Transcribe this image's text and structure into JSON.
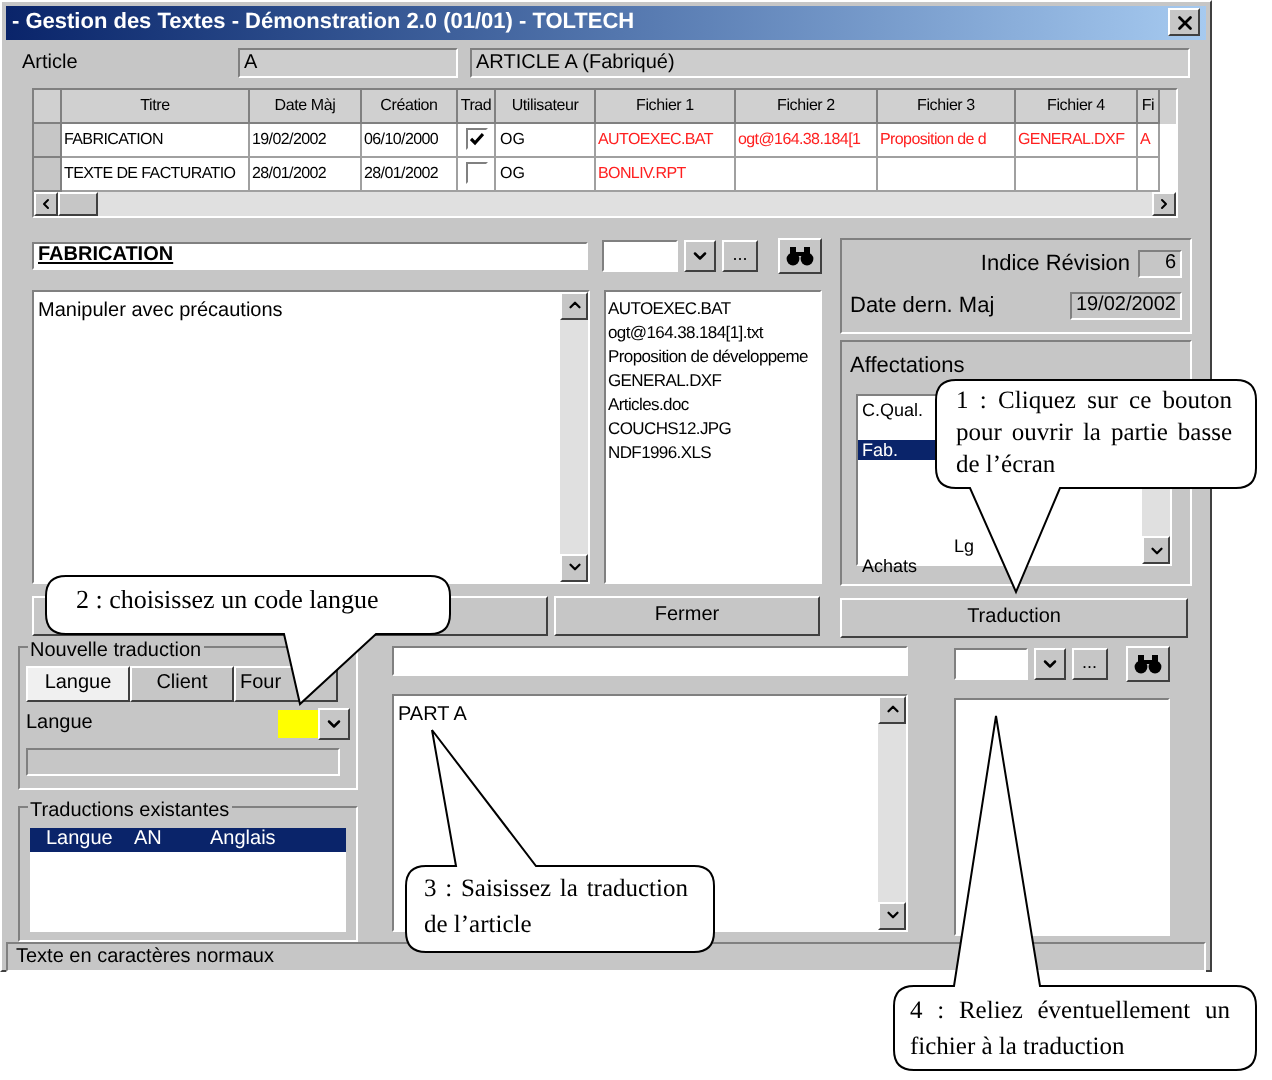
{
  "window": {
    "title": "- Gestion des Textes - Démonstration 2.0 (01/01) - TOLTECH"
  },
  "article": {
    "label": "Article",
    "code": "A",
    "description": "ARTICLE A (Fabriqué)"
  },
  "table": {
    "columns": [
      "Titre",
      "Date Màj",
      "Création",
      "Trad",
      "Utilisateur",
      "Fichier 1",
      "Fichier 2",
      "Fichier 3",
      "Fichier 4",
      "Fi"
    ],
    "rows": [
      {
        "title": "FABRICATION",
        "updated": "19/02/2002",
        "created": "06/10/2000",
        "trad": true,
        "user": "OG",
        "files": [
          "AUTOEXEC.BAT",
          "ogt@164.38.184[1",
          "Proposition de d",
          "GENERAL.DXF",
          "A"
        ]
      },
      {
        "title": "TEXTE DE FACTURATIO",
        "updated": "28/01/2002",
        "created": "28/01/2002",
        "trad": false,
        "user": "OG",
        "files": [
          "BONLIV.RPT"
        ]
      }
    ]
  },
  "text_title": "FABRICATION",
  "memo": "Manipuler avec précautions",
  "file_buttons": [
    "..."
  ],
  "files": [
    "AUTOEXEC.BAT",
    "ogt@164.38.184[1].txt",
    "Proposition de développeme",
    "GENERAL.DXF",
    "Articles.doc",
    "COUCHS12.JPG",
    "NDF1996.XLS"
  ],
  "revision": {
    "label": "Indice Révision",
    "value": "6"
  },
  "last_update": {
    "label": "Date dern. Maj",
    "value": "19/02/2002"
  },
  "affectations": {
    "title": "Affectations",
    "rows": [
      {
        "code": "C.Qual.",
        "selected": false
      },
      {
        "code": "Fab.",
        "selected": true
      },
      {
        "label": "Lg",
        "selected": false
      },
      {
        "code": "Achats",
        "selected": false
      }
    ]
  },
  "buttons": [
    "Fermer",
    "Traduction"
  ],
  "new_translation": {
    "title": "Nouvelle traduction",
    "tabs": [
      {
        "label": "Langue",
        "selected": true
      },
      {
        "label": "Client",
        "selected": false
      },
      {
        "label": "Four",
        "selected": false
      }
    ],
    "language_label": "Langue"
  },
  "existing": {
    "title": "Traductions existantes",
    "rows": [
      {
        "cells": [
          "Langue",
          "AN",
          "Anglais"
        ],
        "selected": true
      }
    ]
  },
  "translation_memo": "PART A",
  "translation_file_buttons": [
    "..."
  ],
  "status_bar": "Texte en caractères normaux",
  "callouts": [
    "1 : Cliquez sur ce bouton pour ouvrir la partie basse de l’écran",
    "2 : choisissez un code langue",
    "3 : Saisissez la traduction de l’article",
    "4 : Reliez éventuellement un fichier à la traduction"
  ]
}
